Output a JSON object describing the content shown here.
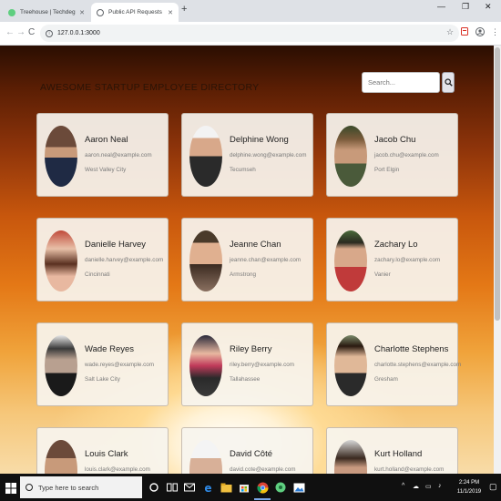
{
  "browser": {
    "tabs": [
      {
        "title": "Treehouse | Techdegree",
        "active": false
      },
      {
        "title": "Public API Requests",
        "active": true
      }
    ],
    "new_tab": "+",
    "window_controls": {
      "minimize": "—",
      "maximize": "❐",
      "close": "✕"
    },
    "address": "127.0.0.1:3000",
    "icons": {
      "back": "←",
      "forward": "→",
      "reload": "C",
      "star": "☆",
      "menu": "⋮"
    }
  },
  "page": {
    "title": "AWESOME STARTUP EMPLOYEE DIRECTORY",
    "search_placeholder": "Search...",
    "employees": [
      {
        "name": "Aaron Neal",
        "email": "aaron.neal@example.com",
        "city": "West Valley City"
      },
      {
        "name": "Delphine Wong",
        "email": "delphine.wong@example.com",
        "city": "Tecumseh"
      },
      {
        "name": "Jacob Chu",
        "email": "jacob.chu@example.com",
        "city": "Port Elgin"
      },
      {
        "name": "Danielle Harvey",
        "email": "danielle.harvey@example.com",
        "city": "Cincinnati"
      },
      {
        "name": "Jeanne Chan",
        "email": "jeanne.chan@example.com",
        "city": "Armstrong"
      },
      {
        "name": "Zachary Lo",
        "email": "zachary.lo@example.com",
        "city": "Vanier"
      },
      {
        "name": "Wade Reyes",
        "email": "wade.reyes@example.com",
        "city": "Salt Lake City"
      },
      {
        "name": "Riley Berry",
        "email": "riley.berry@example.com",
        "city": "Tallahassee"
      },
      {
        "name": "Charlotte Stephens",
        "email": "charlotte.stephens@example.com",
        "city": "Gresham"
      },
      {
        "name": "Louis Clark",
        "email": "louis.clark@example.com",
        "city": ""
      },
      {
        "name": "David Côté",
        "email": "david.cote@example.com",
        "city": ""
      },
      {
        "name": "Kurt Holland",
        "email": "kurt.holland@example.com",
        "city": ""
      }
    ]
  },
  "taskbar": {
    "search_placeholder": "Type here to search",
    "time": "2:24 PM",
    "date": "11/1/2019"
  },
  "colors": {
    "accent_blue": "#1a73e8",
    "taskbar_bg": "#101010",
    "card_bg": "#f7f4ee"
  }
}
